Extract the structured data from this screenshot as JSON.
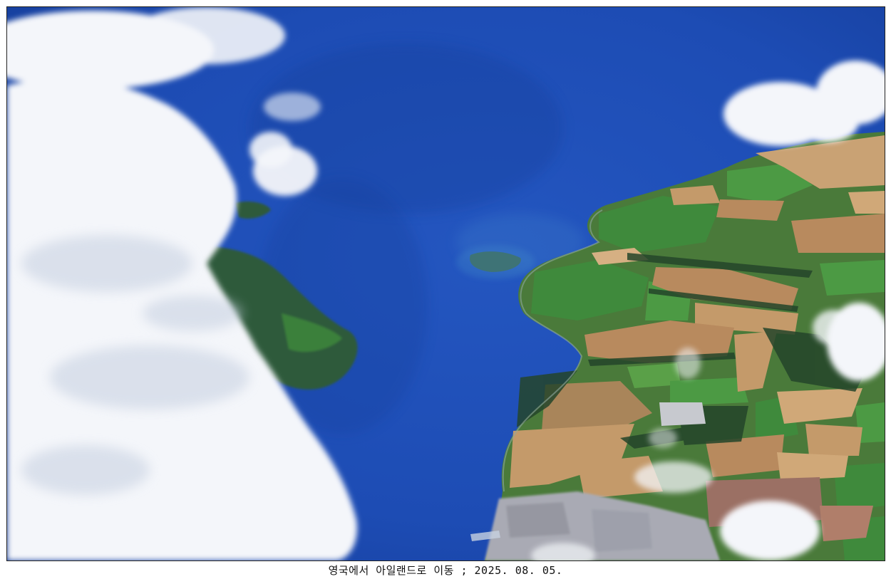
{
  "photo": {
    "subject": "aerial-view-coastline-sea-fields-clouds",
    "colors": {
      "sea": "#1d4cb4",
      "sea_deep": "#163f9c",
      "cloud": "#f4f6fa",
      "field_green": "#3f8a3c",
      "field_tan": "#b88a5e",
      "town": "#a9aab4"
    }
  },
  "caption": {
    "text": "영국에서 아일랜드로 이동 ; 2025. 08. 05."
  }
}
